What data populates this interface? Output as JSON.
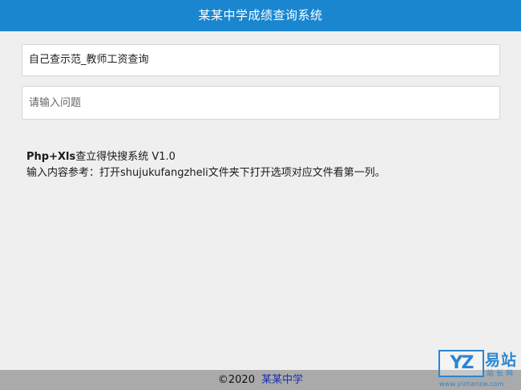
{
  "header": {
    "title": "某某中学成绩查询系统"
  },
  "query_select": {
    "value": "自己查示范_教师工资查询"
  },
  "question_input": {
    "value": "",
    "placeholder": "请输入问题"
  },
  "info": {
    "app_name": "Php+Xls",
    "app_name_suffix": "查立得快搜系统 V1.0",
    "hint": "输入内容参考：打开shujukufangzheli文件夹下打开选项对应文件看第一列。"
  },
  "footer": {
    "copyright": "©2020",
    "school_link": "某某中学"
  },
  "watermark": {
    "logo_text": "YZ",
    "name": "易站",
    "sub": "站长网",
    "url": "www.yizhanzw.com"
  },
  "colors": {
    "header_bg": "#1a86d0",
    "page_bg": "#efefef",
    "footer_bg": "#aaaaaa",
    "link": "#1b2fb0",
    "watermark": "#2b86d1"
  }
}
